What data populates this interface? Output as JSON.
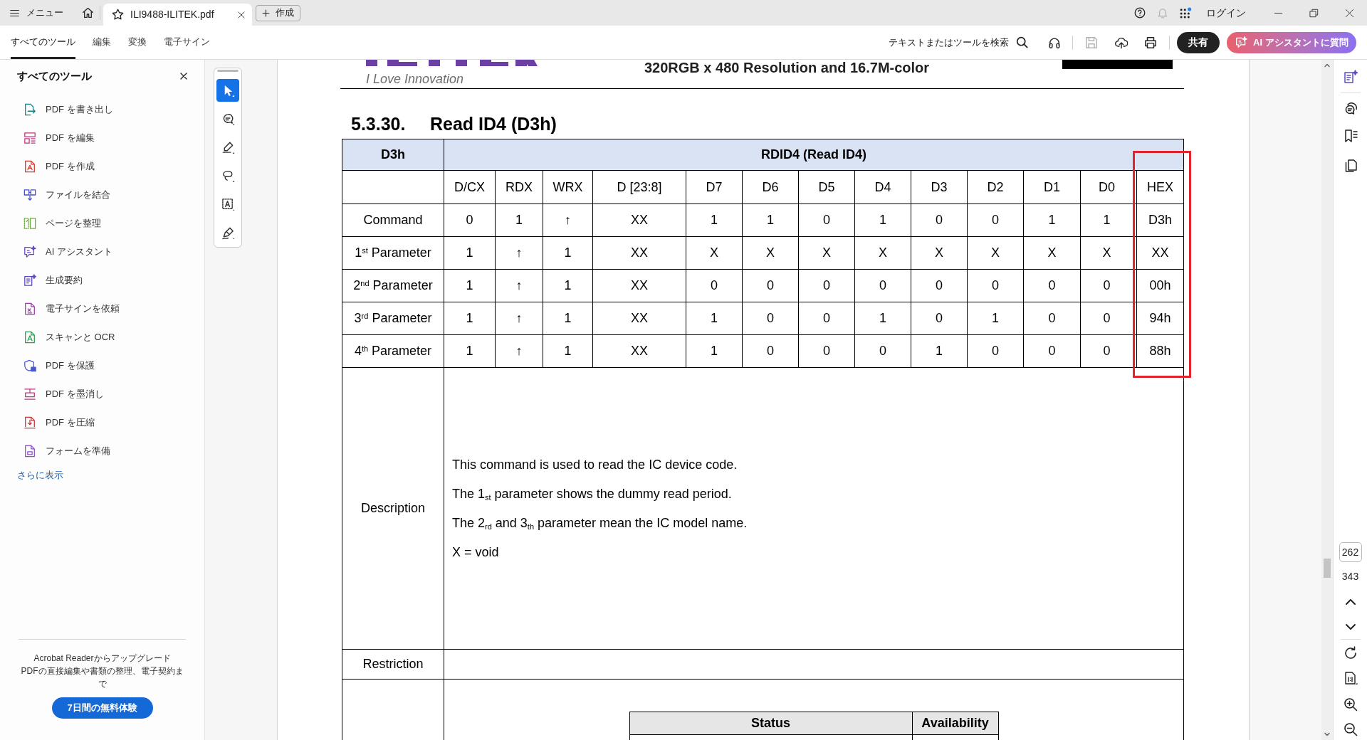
{
  "title_bar": {
    "menu": "メニュー",
    "tabs": [
      {
        "title": "ILI9488-ILITEK.pdf",
        "selected": true
      }
    ],
    "new_button": "作成",
    "login": "ログイン"
  },
  "toolbar": {
    "tabs": [
      {
        "label": "すべてのツール",
        "selected": true
      },
      {
        "label": "編集",
        "selected": false
      },
      {
        "label": "変換",
        "selected": false
      },
      {
        "label": "電子サイン",
        "selected": false
      }
    ],
    "search": "テキストまたはツールを検索",
    "actions": [
      {
        "kind": "listen",
        "disabled": false
      },
      {
        "kind": "save",
        "disabled": true
      },
      {
        "kind": "upload",
        "disabled": false
      },
      {
        "kind": "print",
        "disabled": false
      }
    ],
    "share_button": "共有",
    "ai_button": "AI アシスタントに質問"
  },
  "tools_panel": {
    "title": "すべてのツール",
    "items": [
      {
        "label": "PDF を書き出し"
      },
      {
        "label": "PDF を編集"
      },
      {
        "label": "PDF を作成"
      },
      {
        "label": "ファイルを結合"
      },
      {
        "label": "ページを整理"
      },
      {
        "label": "AI アシスタント"
      },
      {
        "label": "生成要約"
      },
      {
        "label": "電子サインを依頼"
      },
      {
        "label": "スキャンと OCR"
      },
      {
        "label": "PDF を保護"
      },
      {
        "label": "PDF を墨消し"
      },
      {
        "label": "PDF を圧縮"
      },
      {
        "label": "フォームを準備"
      }
    ],
    "more_link": "さらに表示",
    "upgrade": {
      "heading": "Acrobat Readerからアップグレード",
      "text": "PDFの直接編集や書類の整理、電子契約まで",
      "button": "7日間の無料体験"
    }
  },
  "tool_rail": [
    {
      "kind": "select",
      "selected": true
    },
    {
      "kind": "comment",
      "selected": false
    },
    {
      "kind": "highlight",
      "selected": false
    },
    {
      "kind": "draw",
      "selected": false
    },
    {
      "kind": "text_select",
      "selected": false
    },
    {
      "kind": "sign",
      "selected": false
    }
  ],
  "document": {
    "page_header": {
      "tagline": "I Love Innovation",
      "title": "320RGB x 480 Resolution and 16.7M-color"
    },
    "section": {
      "number": "5.3.30.",
      "title": "Read ID4 (D3h)"
    },
    "command_table": {
      "code": "D3h",
      "name": "RDID4 (Read ID4)",
      "columns": [
        {
          "label": "D/CX",
          "highlighted": false
        },
        {
          "label": "RDX",
          "highlighted": false
        },
        {
          "label": "WRX",
          "highlighted": false
        },
        {
          "label": "D [23:8]",
          "highlighted": false
        },
        {
          "label": "D7",
          "highlighted": false
        },
        {
          "label": "D6",
          "highlighted": false
        },
        {
          "label": "D5",
          "highlighted": false
        },
        {
          "label": "D4",
          "highlighted": false
        },
        {
          "label": "D3",
          "highlighted": false
        },
        {
          "label": "D2",
          "highlighted": false
        },
        {
          "label": "D1",
          "highlighted": false
        },
        {
          "label": "D0",
          "highlighted": false
        },
        {
          "label": "HEX",
          "highlighted": true
        }
      ],
      "rows": [
        {
          "label": "Command",
          "cells": [
            "0",
            "1",
            "↑",
            "XX",
            "1",
            "1",
            "0",
            "1",
            "0",
            "0",
            "1",
            "1",
            "D3h"
          ]
        },
        {
          "label": "1$^{st}$ Parameter",
          "cells": [
            "1",
            "↑",
            "1",
            "XX",
            "X",
            "X",
            "X",
            "X",
            "X",
            "X",
            "X",
            "X",
            "XX"
          ]
        },
        {
          "label": "2$^{nd}$ Parameter",
          "cells": [
            "1",
            "↑",
            "1",
            "XX",
            "0",
            "0",
            "0",
            "0",
            "0",
            "0",
            "0",
            "0",
            "00h"
          ]
        },
        {
          "label": "3$^{rd}$ Parameter",
          "cells": [
            "1",
            "↑",
            "1",
            "XX",
            "1",
            "0",
            "0",
            "1",
            "0",
            "1",
            "0",
            "0",
            "94h"
          ]
        },
        {
          "label": "4$^{th}$ Parameter",
          "cells": [
            "1",
            "↑",
            "1",
            "XX",
            "1",
            "0",
            "0",
            "0",
            "1",
            "0",
            "0",
            "0",
            "88h"
          ]
        }
      ],
      "description_label": "Description",
      "description": [
        "This command is used to read the IC device code.",
        "The 1$_{st}$ parameter shows the dummy read period.",
        "The 2$_{rd}$ and 3$_{th}$ parameter mean the IC model name.",
        "X = void"
      ],
      "restriction_label": "Restriction",
      "status_table": {
        "columns": [
          "Status",
          "Availability"
        ]
      }
    }
  },
  "page_nav": {
    "current": "262",
    "total": "343"
  }
}
